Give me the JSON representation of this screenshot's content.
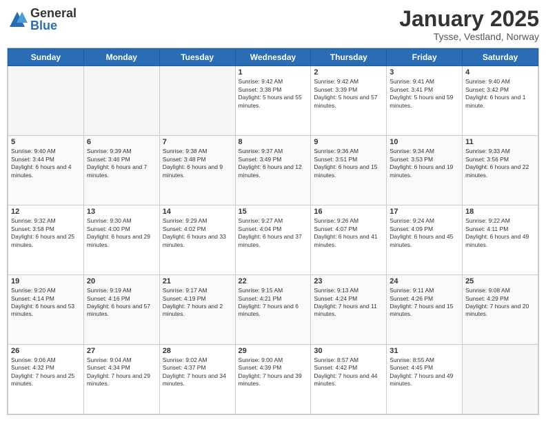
{
  "logo": {
    "general": "General",
    "blue": "Blue"
  },
  "title": "January 2025",
  "location": "Tysse, Vestland, Norway",
  "days_of_week": [
    "Sunday",
    "Monday",
    "Tuesday",
    "Wednesday",
    "Thursday",
    "Friday",
    "Saturday"
  ],
  "weeks": [
    [
      {
        "num": "",
        "info": ""
      },
      {
        "num": "",
        "info": ""
      },
      {
        "num": "",
        "info": ""
      },
      {
        "num": "1",
        "info": "Sunrise: 9:42 AM\nSunset: 3:38 PM\nDaylight: 5 hours and 55 minutes."
      },
      {
        "num": "2",
        "info": "Sunrise: 9:42 AM\nSunset: 3:39 PM\nDaylight: 5 hours and 57 minutes."
      },
      {
        "num": "3",
        "info": "Sunrise: 9:41 AM\nSunset: 3:41 PM\nDaylight: 5 hours and 59 minutes."
      },
      {
        "num": "4",
        "info": "Sunrise: 9:40 AM\nSunset: 3:42 PM\nDaylight: 6 hours and 1 minute."
      }
    ],
    [
      {
        "num": "5",
        "info": "Sunrise: 9:40 AM\nSunset: 3:44 PM\nDaylight: 6 hours and 4 minutes."
      },
      {
        "num": "6",
        "info": "Sunrise: 9:39 AM\nSunset: 3:46 PM\nDaylight: 6 hours and 7 minutes."
      },
      {
        "num": "7",
        "info": "Sunrise: 9:38 AM\nSunset: 3:48 PM\nDaylight: 6 hours and 9 minutes."
      },
      {
        "num": "8",
        "info": "Sunrise: 9:37 AM\nSunset: 3:49 PM\nDaylight: 6 hours and 12 minutes."
      },
      {
        "num": "9",
        "info": "Sunrise: 9:36 AM\nSunset: 3:51 PM\nDaylight: 6 hours and 15 minutes."
      },
      {
        "num": "10",
        "info": "Sunrise: 9:34 AM\nSunset: 3:53 PM\nDaylight: 6 hours and 19 minutes."
      },
      {
        "num": "11",
        "info": "Sunrise: 9:33 AM\nSunset: 3:56 PM\nDaylight: 6 hours and 22 minutes."
      }
    ],
    [
      {
        "num": "12",
        "info": "Sunrise: 9:32 AM\nSunset: 3:58 PM\nDaylight: 6 hours and 25 minutes."
      },
      {
        "num": "13",
        "info": "Sunrise: 9:30 AM\nSunset: 4:00 PM\nDaylight: 6 hours and 29 minutes."
      },
      {
        "num": "14",
        "info": "Sunrise: 9:29 AM\nSunset: 4:02 PM\nDaylight: 6 hours and 33 minutes."
      },
      {
        "num": "15",
        "info": "Sunrise: 9:27 AM\nSunset: 4:04 PM\nDaylight: 6 hours and 37 minutes."
      },
      {
        "num": "16",
        "info": "Sunrise: 9:26 AM\nSunset: 4:07 PM\nDaylight: 6 hours and 41 minutes."
      },
      {
        "num": "17",
        "info": "Sunrise: 9:24 AM\nSunset: 4:09 PM\nDaylight: 6 hours and 45 minutes."
      },
      {
        "num": "18",
        "info": "Sunrise: 9:22 AM\nSunset: 4:11 PM\nDaylight: 6 hours and 49 minutes."
      }
    ],
    [
      {
        "num": "19",
        "info": "Sunrise: 9:20 AM\nSunset: 4:14 PM\nDaylight: 6 hours and 53 minutes."
      },
      {
        "num": "20",
        "info": "Sunrise: 9:19 AM\nSunset: 4:16 PM\nDaylight: 6 hours and 57 minutes."
      },
      {
        "num": "21",
        "info": "Sunrise: 9:17 AM\nSunset: 4:19 PM\nDaylight: 7 hours and 2 minutes."
      },
      {
        "num": "22",
        "info": "Sunrise: 9:15 AM\nSunset: 4:21 PM\nDaylight: 7 hours and 6 minutes."
      },
      {
        "num": "23",
        "info": "Sunrise: 9:13 AM\nSunset: 4:24 PM\nDaylight: 7 hours and 11 minutes."
      },
      {
        "num": "24",
        "info": "Sunrise: 9:11 AM\nSunset: 4:26 PM\nDaylight: 7 hours and 15 minutes."
      },
      {
        "num": "25",
        "info": "Sunrise: 9:08 AM\nSunset: 4:29 PM\nDaylight: 7 hours and 20 minutes."
      }
    ],
    [
      {
        "num": "26",
        "info": "Sunrise: 9:06 AM\nSunset: 4:32 PM\nDaylight: 7 hours and 25 minutes."
      },
      {
        "num": "27",
        "info": "Sunrise: 9:04 AM\nSunset: 4:34 PM\nDaylight: 7 hours and 29 minutes."
      },
      {
        "num": "28",
        "info": "Sunrise: 9:02 AM\nSunset: 4:37 PM\nDaylight: 7 hours and 34 minutes."
      },
      {
        "num": "29",
        "info": "Sunrise: 9:00 AM\nSunset: 4:39 PM\nDaylight: 7 hours and 39 minutes."
      },
      {
        "num": "30",
        "info": "Sunrise: 8:57 AM\nSunset: 4:42 PM\nDaylight: 7 hours and 44 minutes."
      },
      {
        "num": "31",
        "info": "Sunrise: 8:55 AM\nSunset: 4:45 PM\nDaylight: 7 hours and 49 minutes."
      },
      {
        "num": "",
        "info": ""
      }
    ]
  ]
}
